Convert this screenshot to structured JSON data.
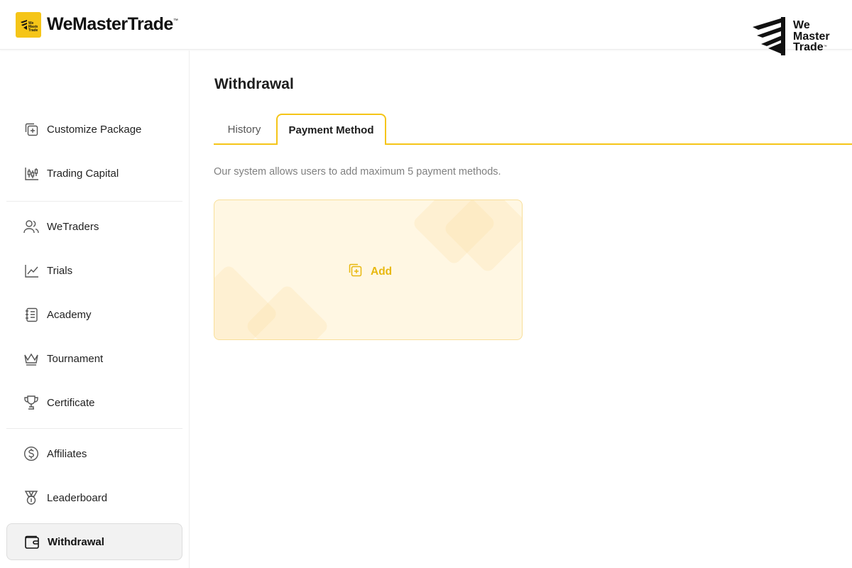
{
  "header": {
    "logo_text": "WeMasterTrade",
    "logo_tm": "™",
    "brand_words": [
      "We",
      "Master",
      "Trade"
    ],
    "brand_tm": "™"
  },
  "sidebar": {
    "items": [
      {
        "label": "Customize Package",
        "icon": "add-copy-icon"
      },
      {
        "label": "Trading Capital",
        "icon": "candlestick-icon"
      },
      {
        "label": "WeTraders",
        "icon": "users-icon"
      },
      {
        "label": "Trials",
        "icon": "line-chart-icon"
      },
      {
        "label": "Academy",
        "icon": "notebook-icon"
      },
      {
        "label": "Tournament",
        "icon": "crown-icon"
      },
      {
        "label": "Certificate",
        "icon": "trophy-icon"
      },
      {
        "label": "Affiliates",
        "icon": "dollar-circle-icon"
      },
      {
        "label": "Leaderboard",
        "icon": "medal-icon"
      },
      {
        "label": "Withdrawal",
        "icon": "wallet-icon",
        "active": true
      }
    ]
  },
  "main": {
    "title": "Withdrawal",
    "tabs": [
      {
        "label": "History",
        "active": false
      },
      {
        "label": "Payment Method",
        "active": true
      }
    ],
    "info": "Our system allows users to add maximum 5 payment methods.",
    "add_label": "Add"
  },
  "colors": {
    "accent": "#f5c518",
    "add_text": "#e8b80e",
    "card_bg": "#fff7e3"
  }
}
